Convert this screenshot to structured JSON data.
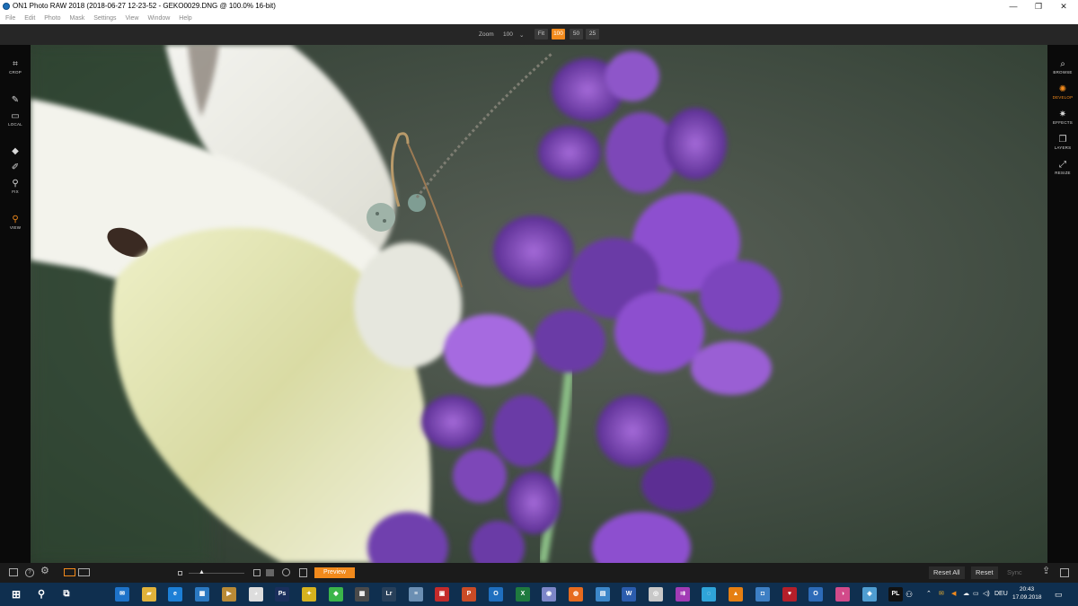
{
  "window": {
    "title": "ON1 Photo RAW 2018 (2018-06-27 12-23-52 - GEKO0029.DNG @ 100.0% 16-bit)",
    "minimize": "—",
    "maximize": "❐",
    "close": "✕"
  },
  "menu": [
    "File",
    "Edit",
    "Photo",
    "Mask",
    "Settings",
    "View",
    "Window",
    "Help"
  ],
  "zoom": {
    "label": "Zoom",
    "value": "100",
    "caret": "⌄",
    "buttons": [
      {
        "label": "Fit",
        "active": false
      },
      {
        "label": "100",
        "active": true
      },
      {
        "label": "50",
        "active": false
      },
      {
        "label": "25",
        "active": false
      }
    ]
  },
  "left_tools": [
    {
      "label": "CROP",
      "icon": "crop-icon",
      "glyph": "⌗"
    },
    {
      "label": "",
      "icon": "brush-icon",
      "glyph": "✎"
    },
    {
      "label": "LOCAL",
      "icon": "local-icon",
      "glyph": "▭"
    },
    {
      "label": "",
      "icon": "eraser-icon",
      "glyph": "◆"
    },
    {
      "label": "",
      "icon": "healing-icon",
      "glyph": "✐"
    },
    {
      "label": "FIX",
      "icon": "stamp-icon",
      "glyph": "⚲"
    },
    {
      "label": "VIEW",
      "icon": "zoom-icon",
      "glyph": "⚲"
    }
  ],
  "right_tools": [
    {
      "label": "BROWSE",
      "icon": "browse-icon",
      "glyph": "⌕",
      "active": false
    },
    {
      "label": "DEVELOP",
      "icon": "develop-icon",
      "glyph": "✺",
      "active": true
    },
    {
      "label": "EFFECTS",
      "icon": "effects-icon",
      "glyph": "✷",
      "active": false
    },
    {
      "label": "LAYERS",
      "icon": "layers-icon",
      "glyph": "❐",
      "active": false
    },
    {
      "label": "RESIZE",
      "icon": "resize-icon",
      "glyph": "⤢",
      "active": false
    }
  ],
  "bottom": {
    "preview_label": "Preview",
    "reset_all": "Reset All",
    "reset": "Reset",
    "sync": "Sync"
  },
  "taskbar": {
    "apps": [
      {
        "icon": "mail-icon",
        "glyph": "✉",
        "color": "#1e73c9"
      },
      {
        "icon": "file-explorer-icon",
        "glyph": "▰",
        "color": "#e0b23a"
      },
      {
        "icon": "edge-icon",
        "glyph": "e",
        "color": "#1c7fd6"
      },
      {
        "icon": "store-icon",
        "glyph": "▦",
        "color": "#2b79c2"
      },
      {
        "icon": "media-icon",
        "glyph": "▶",
        "color": "#b98a36"
      },
      {
        "icon": "panda-icon",
        "glyph": "◕",
        "color": "#dddddd"
      },
      {
        "icon": "photoshop-icon",
        "glyph": "Ps",
        "color": "#1a2f5c"
      },
      {
        "icon": "app-yellow-icon",
        "glyph": "✦",
        "color": "#d6b21e"
      },
      {
        "icon": "app-color-icon",
        "glyph": "◆",
        "color": "#3bb54a"
      },
      {
        "icon": "calculator-icon",
        "glyph": "▦",
        "color": "#4a4a4a"
      },
      {
        "icon": "lightroom-icon",
        "glyph": "Lr",
        "color": "#28405a"
      },
      {
        "icon": "app-stripes-icon",
        "glyph": "≡",
        "color": "#6b8fb3"
      },
      {
        "icon": "app-red-icon",
        "glyph": "▣",
        "color": "#c42b2b"
      },
      {
        "icon": "powerpoint-icon",
        "glyph": "P",
        "color": "#c94b26"
      },
      {
        "icon": "outlook-icon",
        "glyph": "O",
        "color": "#1f6fbf"
      },
      {
        "icon": "excel-icon",
        "glyph": "X",
        "color": "#1f7a3e"
      },
      {
        "icon": "app-globe-icon",
        "glyph": "◉",
        "color": "#7c86c8"
      },
      {
        "icon": "firefox-icon",
        "glyph": "◍",
        "color": "#e66b1f"
      },
      {
        "icon": "app-blue-icon",
        "glyph": "▤",
        "color": "#3c87c9"
      },
      {
        "icon": "word-icon",
        "glyph": "W",
        "color": "#2b5cad"
      },
      {
        "icon": "app-white-icon",
        "glyph": "◎",
        "color": "#c8c8c8"
      },
      {
        "icon": "app-purple-icon",
        "glyph": "⇉",
        "color": "#a23bb5"
      },
      {
        "icon": "app-cyan-icon",
        "glyph": "◌",
        "color": "#2fa4d9"
      },
      {
        "icon": "vlc-icon",
        "glyph": "▲",
        "color": "#e57f12"
      },
      {
        "icon": "camera-icon",
        "glyph": "◘",
        "color": "#3d7fc4"
      },
      {
        "icon": "app-heart-icon",
        "glyph": "♥",
        "color": "#b51f2a"
      },
      {
        "icon": "outlook2-icon",
        "glyph": "O",
        "color": "#2d6bb8"
      },
      {
        "icon": "app-pink-icon",
        "glyph": "◑",
        "color": "#d24a8a"
      },
      {
        "icon": "app-gem-icon",
        "glyph": "◈",
        "color": "#4f9dd1"
      },
      {
        "icon": "photolab-icon",
        "glyph": "PL",
        "color": "#111111"
      }
    ],
    "language": "DEU",
    "time": "20:43",
    "date": "17.09.2018"
  }
}
